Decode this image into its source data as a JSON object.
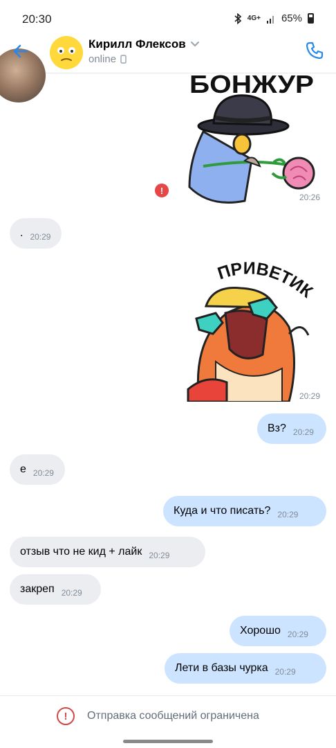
{
  "status_bar": {
    "time": "20:30",
    "network": "4G+",
    "battery": "65%"
  },
  "header": {
    "contact_name": "Кирилл Флексов",
    "contact_status": "online"
  },
  "messages": [
    {
      "type": "sticker",
      "direction": "out",
      "caption": "БОНЖУР",
      "time": "20:26",
      "failed": true
    },
    {
      "type": "text",
      "direction": "in",
      "text": ".",
      "time": "20:29"
    },
    {
      "type": "sticker",
      "direction": "out",
      "caption": "ПРИВЕТИК",
      "time": "20:29"
    },
    {
      "type": "text",
      "direction": "out",
      "text": "Вз?",
      "time": "20:29"
    },
    {
      "type": "text",
      "direction": "in",
      "text": "е",
      "time": "20:29"
    },
    {
      "type": "text",
      "direction": "out",
      "text": "Куда и что писать?",
      "time": "20:29"
    },
    {
      "type": "text",
      "direction": "in",
      "text": "отзыв что не кид + лайк",
      "time": "20:29"
    },
    {
      "type": "text",
      "direction": "in",
      "text": "закреп",
      "time": "20:29"
    },
    {
      "type": "text",
      "direction": "out",
      "text": "Хорошо",
      "time": "20:29"
    },
    {
      "type": "text",
      "direction": "out",
      "text": "Лети в базы чурка",
      "time": "20:29"
    }
  ],
  "error_badge": "!",
  "restriction": {
    "icon": "!",
    "text": "Отправка сообщений ограничена"
  },
  "colors": {
    "accent": "#2688eb",
    "bubble_in": "#ebedf0",
    "bubble_out": "#cce4ff",
    "error": "#e64646"
  }
}
